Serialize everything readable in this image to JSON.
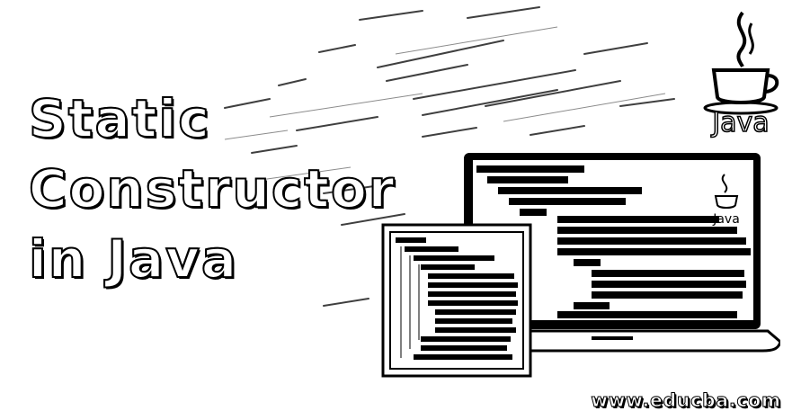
{
  "title": {
    "line1": "Static",
    "line2": "Constructor",
    "line3": "in Java"
  },
  "logo": {
    "wordmark": "Java"
  },
  "laptop_logo": {
    "wordmark": "Java"
  },
  "footer": {
    "url": "www.educba.com"
  },
  "colors": {
    "background": "#ffffff",
    "ink": "#000000"
  },
  "icons": [
    "java-coffee-cup-icon",
    "laptop-icon",
    "tablet-icon"
  ]
}
